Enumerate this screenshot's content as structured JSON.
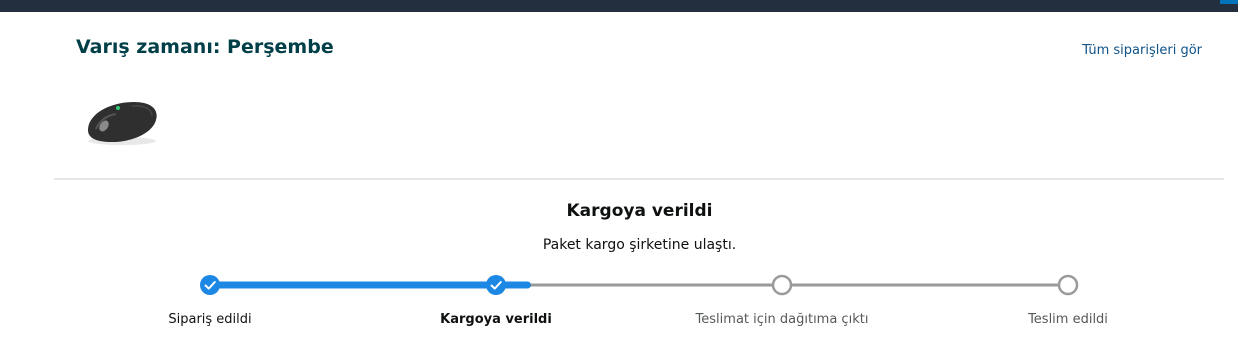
{
  "header": {
    "arrival_title": "Varış zamanı: Perşembe",
    "all_orders_link": "Tüm siparişleri gör"
  },
  "product": {
    "image_icon": "wireless-mouse-icon"
  },
  "shipment": {
    "status_title": "Kargoya verildi",
    "status_subtitle": "Paket kargo şirketine ulaştı.",
    "progress_fraction": 0.37,
    "steps": [
      {
        "label": "Sipariş edildi",
        "state": "done"
      },
      {
        "label": "Kargoya verildi",
        "state": "current"
      },
      {
        "label": "Teslimat için dağıtıma çıktı",
        "state": "pending"
      },
      {
        "label": "Teslim edildi",
        "state": "pending"
      }
    ]
  },
  "colors": {
    "topbar": "#232f3e",
    "progress_active": "#1d87e4",
    "progress_track": "#9a9a9a",
    "title": "#003f48",
    "link": "#0f5286"
  }
}
